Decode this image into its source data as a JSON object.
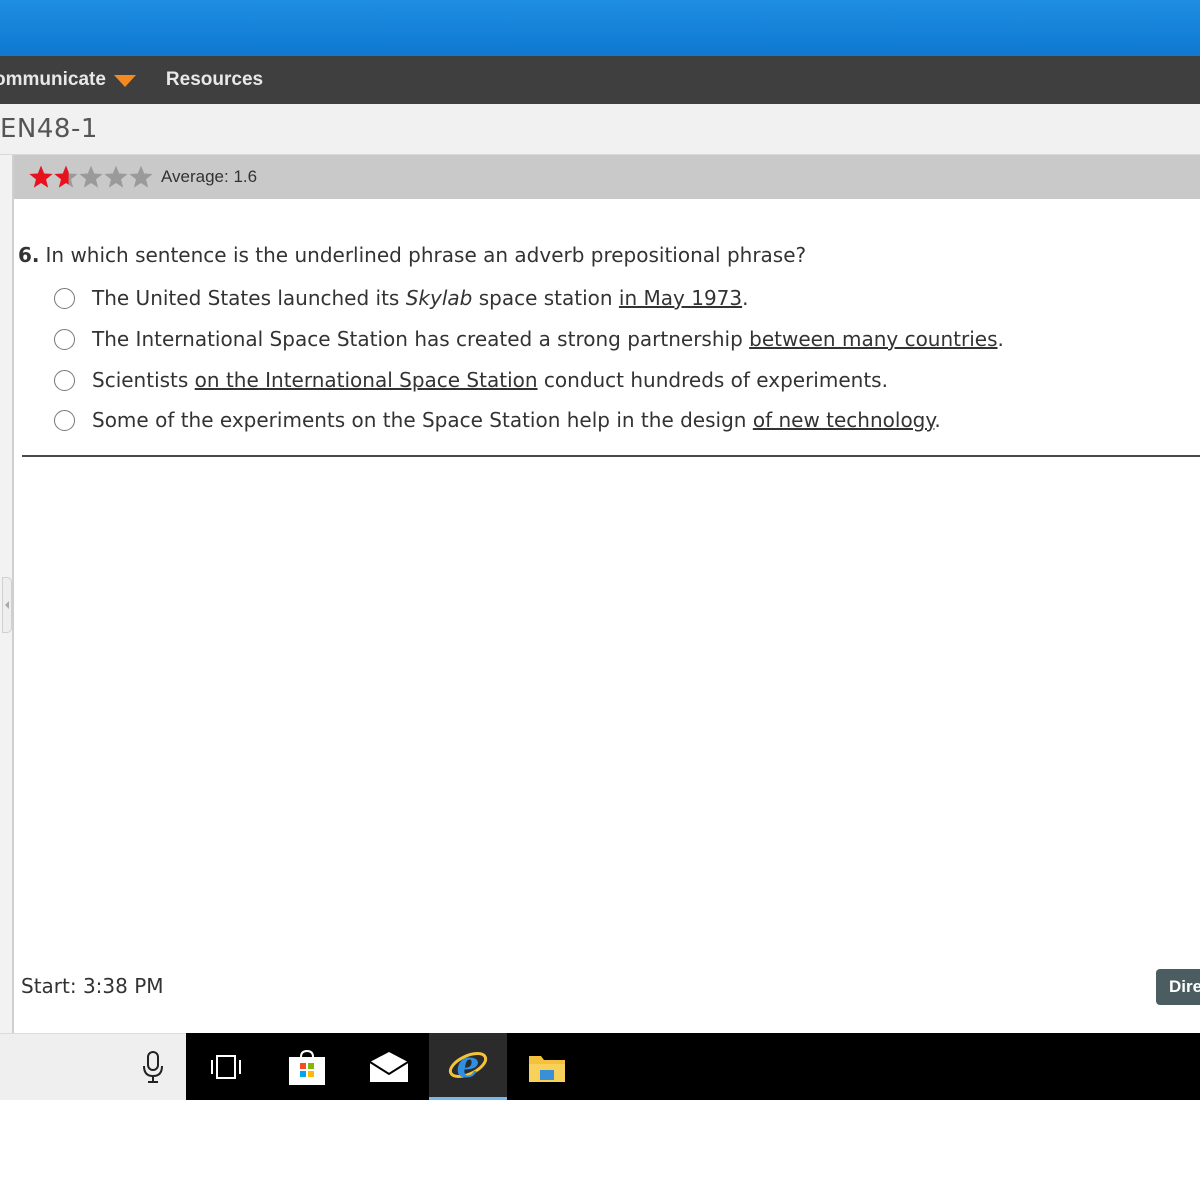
{
  "nav": {
    "communicate_label": "ommunicate",
    "resources_label": "Resources"
  },
  "page": {
    "title": "EN48-1"
  },
  "rating": {
    "average_text": "Average: 1.6",
    "average_value": 1.6,
    "max_stars": 5,
    "filled_color": "#e8121f",
    "empty_color": "#9a9a9a"
  },
  "question": {
    "number": "6.",
    "text": "In which sentence is the underlined phrase an adverb prepositional phrase?",
    "options": [
      {
        "before": "The United States launched its ",
        "italic": "Skylab",
        "middle": " space station ",
        "underlined": "in May 1973",
        "after": "."
      },
      {
        "before": "The International Space Station has created a strong partnership ",
        "underlined": "between many countries",
        "after": "."
      },
      {
        "before": "Scientists ",
        "underlined": "on the International Space Station",
        "after": " conduct hundreds of experiments."
      },
      {
        "before": "Some of the experiments on the Space Station help in the design ",
        "underlined": "of new technology",
        "after": "."
      }
    ]
  },
  "footer": {
    "start_text": "Start: 3:38 PM",
    "directions_label": "Dire"
  },
  "taskbar": {
    "icons": [
      "microphone-icon",
      "task-view-icon",
      "store-icon",
      "mail-icon",
      "internet-explorer-icon",
      "file-explorer-icon"
    ],
    "active": "internet-explorer-icon"
  },
  "colors": {
    "topbar": "#1581dc",
    "navbar": "#3f3f3f",
    "nav_caret": "#f4891f",
    "directions_button": "#4b5d61",
    "taskbar": "#000000"
  }
}
